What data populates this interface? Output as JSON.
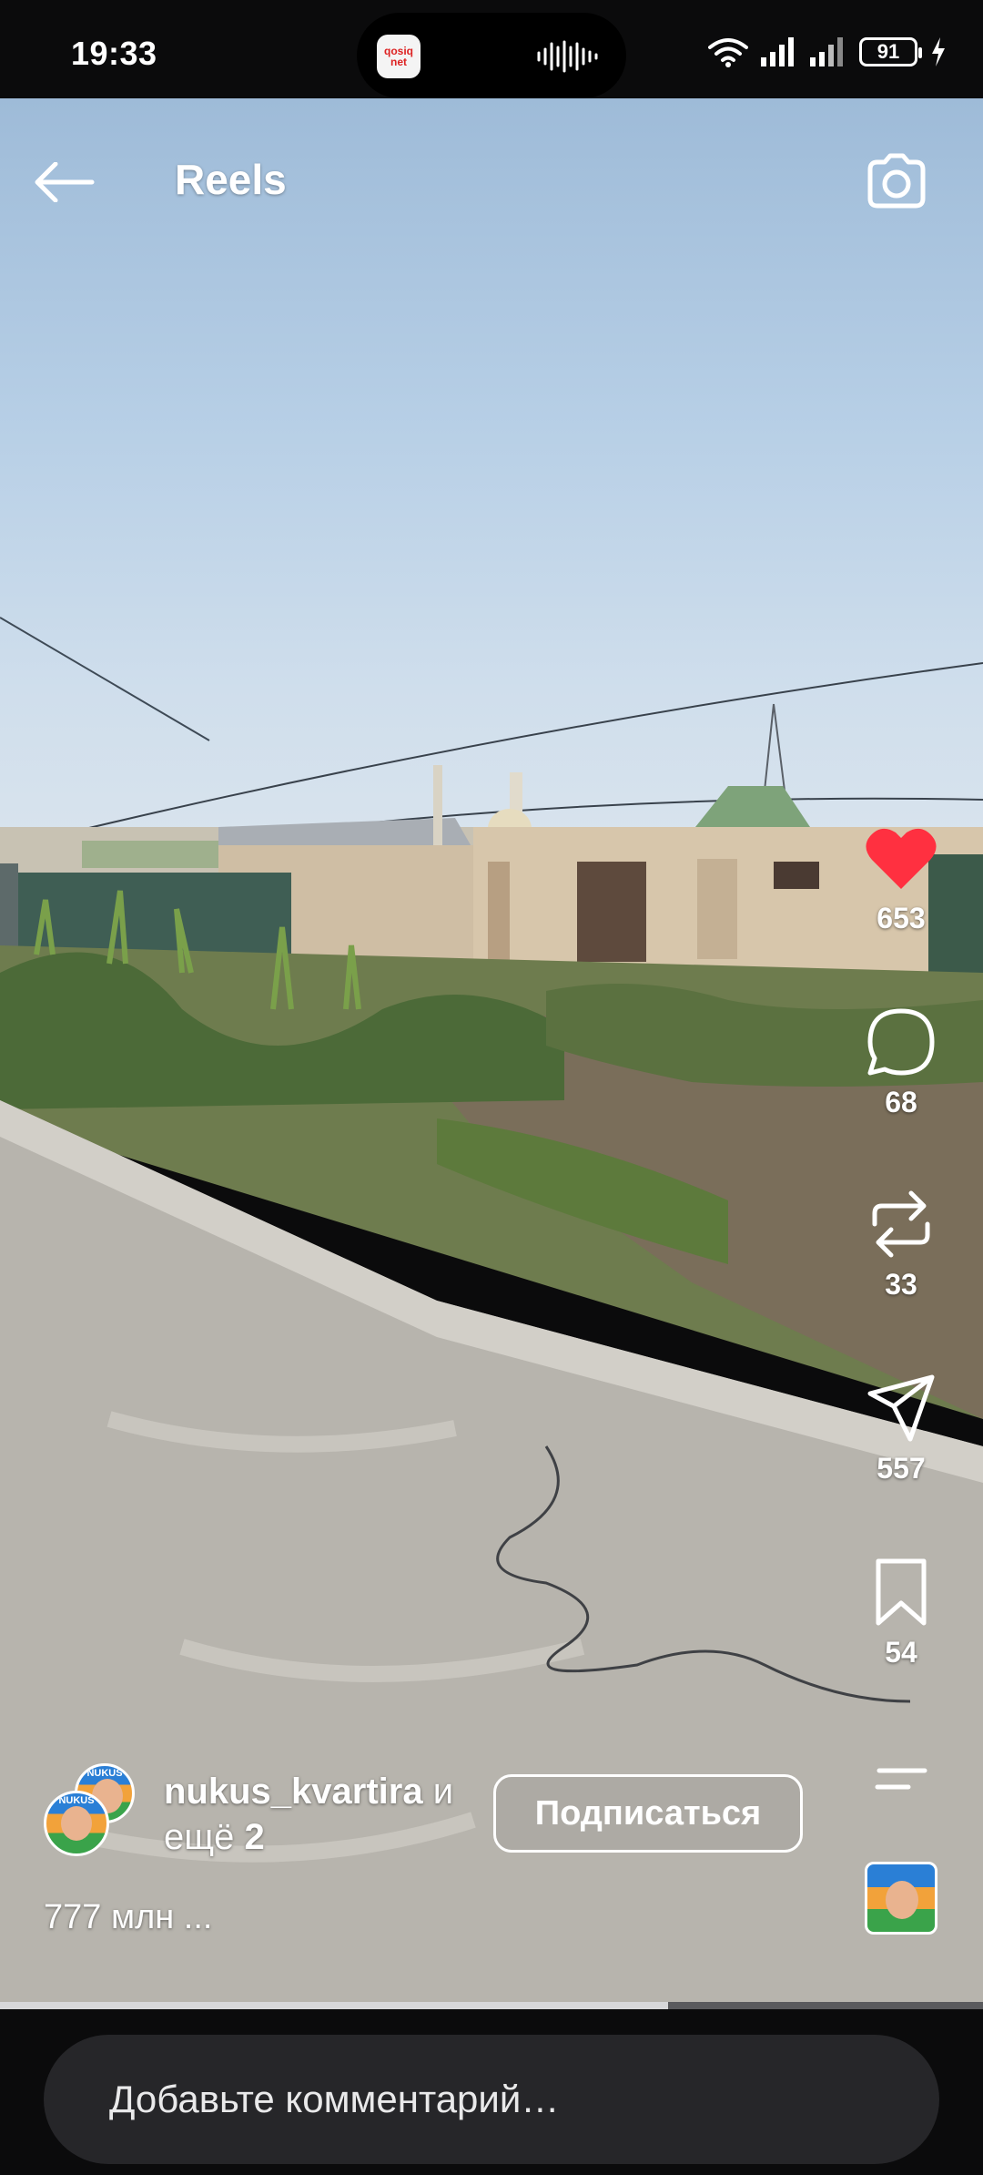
{
  "status_bar": {
    "time": "19:33",
    "app_badge": "qosiq net",
    "battery_level": "91",
    "icons": [
      "wifi-icon",
      "signal-icon",
      "signal-icon",
      "battery-icon",
      "charging-icon"
    ]
  },
  "header": {
    "title": "Reels",
    "back_icon": "arrow-left-icon",
    "camera_icon": "camera-icon"
  },
  "actions": {
    "like": {
      "count": "653",
      "icon": "heart-icon",
      "liked": true,
      "color": "#ff3040"
    },
    "comment": {
      "count": "68",
      "icon": "comment-icon"
    },
    "repost": {
      "count": "33",
      "icon": "repost-icon"
    },
    "share": {
      "count": "557",
      "icon": "send-icon"
    },
    "save": {
      "count": "54",
      "icon": "bookmark-icon"
    },
    "more_icon": "more-lines-icon"
  },
  "post": {
    "username": "nukus_kvartira",
    "coauthors_prefix": "и",
    "coauthors_text": "ещё",
    "coauthors_count": "2",
    "avatar_label": "NUKUS",
    "follow_label": "Подписаться",
    "caption": "777 млн ..."
  },
  "progress": {
    "fraction": 0.68
  },
  "comment": {
    "placeholder": "Добавьте комментарий…"
  }
}
